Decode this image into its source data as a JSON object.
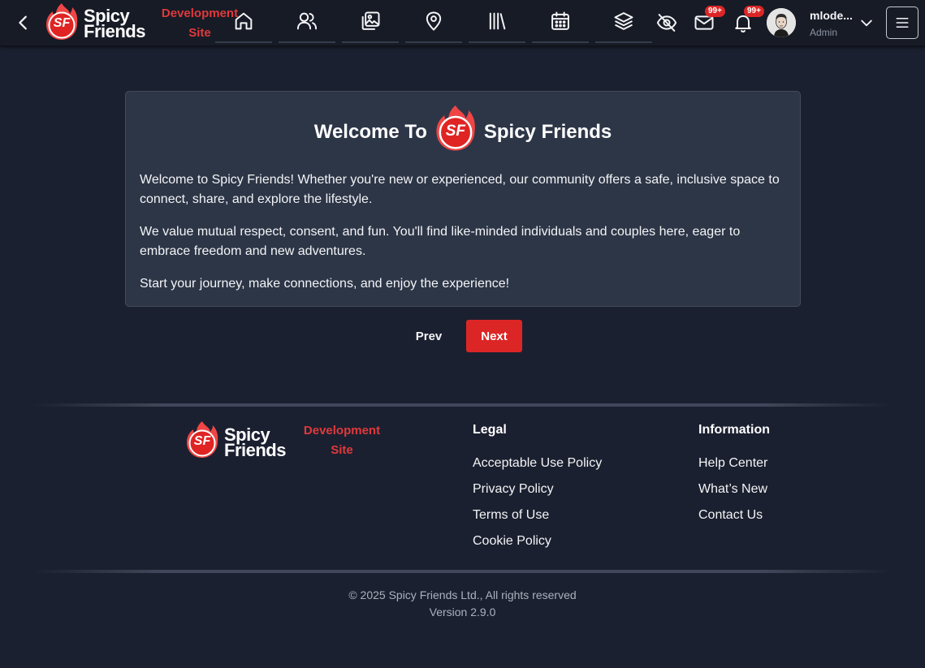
{
  "header": {
    "brand": {
      "line1": "Spicy",
      "line2": "Friends",
      "logo_letters": "SF"
    },
    "dev_badge": {
      "line1": "Development",
      "line2": "Site"
    },
    "nav": [
      {
        "name": "home",
        "icon": "home-icon"
      },
      {
        "name": "people",
        "icon": "users-icon"
      },
      {
        "name": "gallery",
        "icon": "images-icon"
      },
      {
        "name": "locations",
        "icon": "map-pin-icon"
      },
      {
        "name": "library",
        "icon": "library-icon"
      },
      {
        "name": "calendar",
        "icon": "calendar-icon"
      },
      {
        "name": "layers",
        "icon": "layers-icon"
      }
    ],
    "messages_badge": "99+",
    "notifications_badge": "99+",
    "user": {
      "name": "mlode...",
      "role": "Admin"
    }
  },
  "welcome": {
    "title_before": "Welcome To",
    "title_after": "Spicy Friends",
    "logo_letters": "SF",
    "paragraphs": [
      "Welcome to Spicy Friends! Whether you're new or experienced, our community offers a safe, inclusive space to connect, share, and explore the lifestyle.",
      "We value mutual respect, consent, and fun. You'll find like-minded individuals and couples here, eager to embrace freedom and new adventures.",
      "Start your journey, make connections, and enjoy the experience!"
    ],
    "prev_label": "Prev",
    "next_label": "Next"
  },
  "footer": {
    "brand": {
      "line1": "Spicy",
      "line2": "Friends",
      "logo_letters": "SF"
    },
    "dev_badge": {
      "line1": "Development",
      "line2": "Site"
    },
    "legal": {
      "heading": "Legal",
      "links": [
        "Acceptable Use Policy",
        "Privacy Policy",
        "Terms of Use",
        "Cookie Policy"
      ]
    },
    "information": {
      "heading": "Information",
      "links": [
        "Help Center",
        "What’s New",
        "Contact Us"
      ]
    },
    "copyright": "© 2025 Spicy Friends Ltd., All rights reserved",
    "version": "Version 2.9.0"
  },
  "colors": {
    "accent": "#dc2626",
    "background": "#1b2030",
    "card": "#2d3647",
    "topbar": "#171b26"
  }
}
